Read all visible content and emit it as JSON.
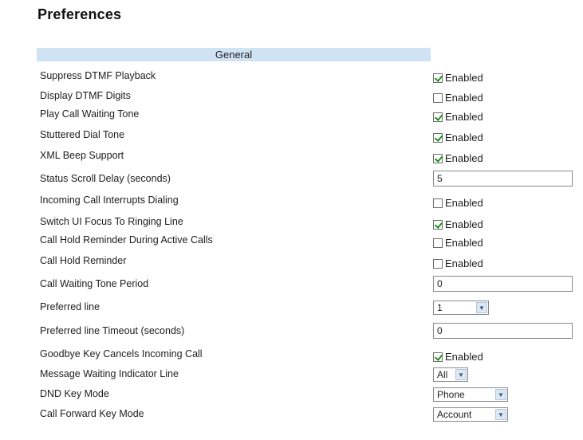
{
  "page": {
    "title": "Preferences"
  },
  "section": {
    "title": "General"
  },
  "rows": {
    "suppress_dtmf": {
      "label": "Suppress DTMF Playback",
      "control": "Enabled",
      "checked": true
    },
    "display_dtmf": {
      "label": "Display DTMF Digits",
      "control": "Enabled",
      "checked": false
    },
    "play_cw_tone": {
      "label": "Play Call Waiting Tone",
      "control": "Enabled",
      "checked": true
    },
    "stuttered_dial": {
      "label": "Stuttered Dial Tone",
      "control": "Enabled",
      "checked": true
    },
    "xml_beep": {
      "label": "XML Beep Support",
      "control": "Enabled",
      "checked": true
    },
    "status_scroll": {
      "label": "Status Scroll Delay (seconds)",
      "value": "5"
    },
    "incoming_interrupts": {
      "label": "Incoming Call Interrupts Dialing",
      "control": "Enabled",
      "checked": false
    },
    "switch_focus": {
      "label": "Switch UI Focus To Ringing Line",
      "control": "Enabled",
      "checked": true
    },
    "hold_reminder_active": {
      "label": "Call Hold Reminder During Active Calls",
      "control": "Enabled",
      "checked": false
    },
    "hold_reminder": {
      "label": "Call Hold Reminder",
      "control": "Enabled",
      "checked": false
    },
    "cw_tone_period": {
      "label": "Call Waiting Tone Period",
      "value": "0"
    },
    "preferred_line": {
      "label": "Preferred line",
      "value": "1"
    },
    "preferred_timeout": {
      "label": "Preferred line Timeout (seconds)",
      "value": "0"
    },
    "goodbye_cancels": {
      "label": "Goodbye Key Cancels Incoming Call",
      "control": "Enabled",
      "checked": true
    },
    "mwi_line": {
      "label": "Message Waiting Indicator Line",
      "value": "All"
    },
    "dnd_mode": {
      "label": "DND Key Mode",
      "value": "Phone"
    },
    "cfwd_mode": {
      "label": "Call Forward Key Mode",
      "value": "Account"
    }
  }
}
